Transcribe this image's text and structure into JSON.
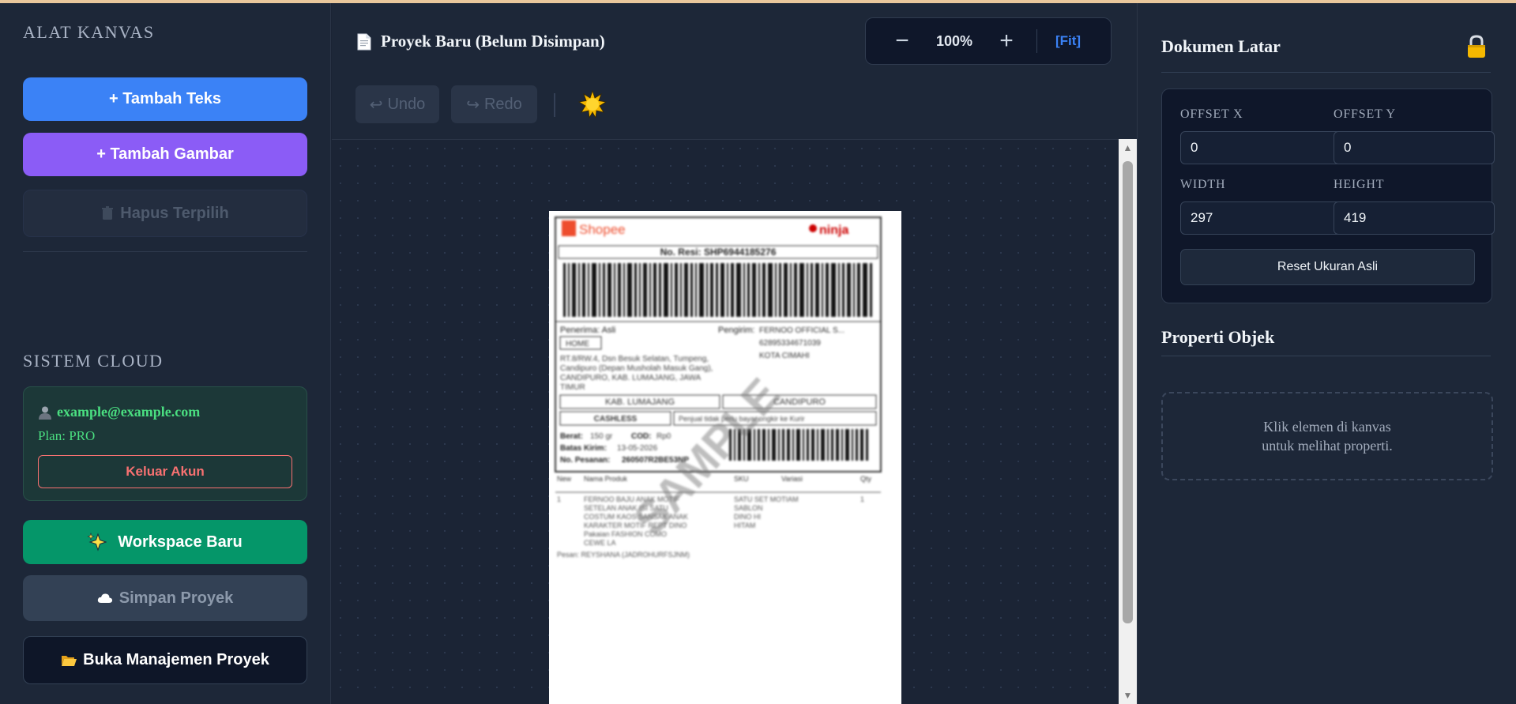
{
  "sidebar": {
    "canvas_tools_title": "ALAT KANVAS",
    "add_text_label": "+ Tambah Teks",
    "add_image_label": "+ Tambah Gambar",
    "delete_selected_label": "Hapus Terpilih",
    "cloud_title": "SISTEM CLOUD",
    "user_email": "example@example.com",
    "plan_label": "Plan: PRO",
    "logout_label": "Keluar Akun",
    "new_workspace_label": "Workspace Baru",
    "save_project_label": "Simpan Proyek",
    "open_project_manager_label": "Buka Manajemen Proyek"
  },
  "header": {
    "doc_title": "Proyek Baru (Belum Disimpan)",
    "zoom_value": "100%",
    "fit_label": "[Fit]"
  },
  "toolbar": {
    "undo_label": "Undo",
    "redo_label": "Redo"
  },
  "canvas": {
    "label": {
      "brand": "Shopee",
      "courier": "ninja",
      "resi": "No. Resi: SHP6944185276",
      "recipient_heading": "Penerima: Asli",
      "recipient_tag": "HOME",
      "recipient_address": [
        "RT.8/RW.4, Dsn Besuk Selatan, Tumpeng,",
        "Candipuro (Depan Musholah Masuk Gang),",
        "CANDIPURO, KAB. LUMAJANG, JAWA",
        "TIMUR"
      ],
      "sender_heading": "Pengirim:",
      "sender_name": "FERNOO OFFICIAL S...",
      "sender_phone": "62895334671039",
      "sender_city": "KOTA CIMAHI",
      "district": "KAB. LUMAJANG",
      "subdistrict": "CANDIPURO",
      "payment": "CASHLESS",
      "seller_note": "Penjual tidak perlu bayar ongkir ke Kurir",
      "weight_label": "Berat:",
      "weight_value": "150 gr",
      "cod_label": "COD:",
      "cod_value": "Rp0",
      "deadline_label": "Batas Kirim:",
      "deadline_value": "13-05-2026",
      "order_label": "No. Pesanan:",
      "order_value": "260507R2BE53NP",
      "table_headers": [
        "New",
        "Nama Produk",
        "SKU",
        "Variasi",
        "Qty"
      ],
      "item_no": "1",
      "item_name": [
        "FERNOO BAJU ANAK MOTIF",
        "SETELAN ANAK ISI SATU",
        "COSTUM KAOS SANSAK ANAK",
        "KARAKTER MOTIF REPT DINO",
        "Pakaian FASHION COMO",
        "CEWE LA"
      ],
      "item_variant": [
        "SATU SET MOTIAM",
        "SABLON",
        "DINO HI",
        "HITAM"
      ],
      "item_qty": "1",
      "buyer_note": "Pesan: REYSHANA (JADROHURFSJNM)",
      "watermark": "SAMPLE"
    }
  },
  "right_panel": {
    "background_title": "Dokumen Latar",
    "offset_x_label": "OFFSET X",
    "offset_y_label": "OFFSET Y",
    "offset_x_value": "0",
    "offset_y_value": "0",
    "width_label": "WIDTH",
    "height_label": "HEIGHT",
    "width_value": "297",
    "height_value": "419",
    "reset_label": "Reset Ukuran Asli",
    "properties_title": "Properti Objek",
    "placeholder_line1": "Klik elemen di kanvas",
    "placeholder_line2": "untuk melihat properti."
  },
  "colors": {
    "accent_blue": "#3b82f6",
    "accent_purple": "#8b5cf6",
    "accent_green": "#059669",
    "success_text": "#4ade80",
    "danger": "#f87171",
    "lock": "#f5b800"
  },
  "icons": {
    "document": "document-icon",
    "trash": "trash-icon",
    "user": "user-icon",
    "sparkles": "sparkles-icon",
    "cloud": "cloud-icon",
    "folder": "folder-open-icon",
    "undo": "undo-arrow-icon",
    "redo": "redo-arrow-icon",
    "theme": "sun-icon",
    "lock": "lock-icon"
  }
}
